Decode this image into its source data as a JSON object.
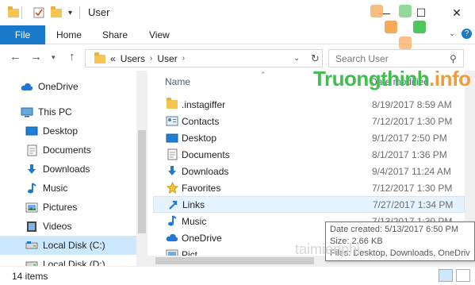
{
  "window": {
    "title": "User",
    "minimize_glyph": "—",
    "maximize_glyph": "☐",
    "close_glyph": "✕"
  },
  "ribbon": {
    "file_tab": "File",
    "tabs": [
      "Home",
      "Share",
      "View"
    ]
  },
  "navbar": {
    "breadcrumb_prefix": "«",
    "breadcrumb": [
      "Users",
      "User"
    ],
    "search_placeholder": "Search User"
  },
  "nav_pane": {
    "items": [
      {
        "label": "OneDrive",
        "icon": "cloud-icon"
      },
      {
        "label": "This PC",
        "icon": "computer-icon"
      },
      {
        "label": "Desktop",
        "icon": "desktop-icon"
      },
      {
        "label": "Documents",
        "icon": "documents-icon"
      },
      {
        "label": "Downloads",
        "icon": "downloads-icon"
      },
      {
        "label": "Music",
        "icon": "music-icon"
      },
      {
        "label": "Pictures",
        "icon": "pictures-icon"
      },
      {
        "label": "Videos",
        "icon": "videos-icon"
      },
      {
        "label": "Local Disk (C:)",
        "icon": "drive-icon",
        "selected": true
      },
      {
        "label": "Local Disk (D:)",
        "icon": "drive-icon"
      }
    ]
  },
  "file_list": {
    "col_name": "Name",
    "col_date": "Date modified",
    "rows": [
      {
        "name": ".instagiffer",
        "date": "8/19/2017 8:59 AM",
        "icon": "folder-icon"
      },
      {
        "name": "Contacts",
        "date": "7/12/2017 1:30 PM",
        "icon": "contacts-icon"
      },
      {
        "name": "Desktop",
        "date": "9/1/2017 2:50 PM",
        "icon": "desktop-icon"
      },
      {
        "name": "Documents",
        "date": "8/1/2017 1:36 PM",
        "icon": "documents-icon"
      },
      {
        "name": "Downloads",
        "date": "9/4/2017 11:24 AM",
        "icon": "downloads-icon"
      },
      {
        "name": "Favorites",
        "date": "7/12/2017 1:30 PM",
        "icon": "star-icon"
      },
      {
        "name": "Links",
        "date": "7/27/2017 1:34 PM",
        "icon": "links-icon",
        "hover": true
      },
      {
        "name": "Music",
        "date": "7/13/2017 1:30 PM",
        "icon": "music-icon"
      },
      {
        "name": "OneDrive",
        "date": "",
        "icon": "cloud-icon"
      },
      {
        "name": "Pict",
        "date": "",
        "icon": "pictures-icon"
      }
    ]
  },
  "tooltip": {
    "line1": "Date created: 5/13/2017 6:50 PM",
    "line2": "Size: 2.66 KB",
    "line3": "Files: Desktop, Downloads, OneDriv"
  },
  "status": {
    "items_count": "14 items"
  },
  "watermark": {
    "logo_text_a": "Truongthinh",
    "logo_text_b": ".info",
    "bottom_text": "taimienphi"
  },
  "colors": {
    "accent": "#1979ca",
    "selected_bg": "#cce8ff",
    "hover_bg": "#e5f3ff",
    "folder": "#f5c452",
    "logo_green": "#3fbf4d",
    "logo_orange": "#f39a3c"
  }
}
